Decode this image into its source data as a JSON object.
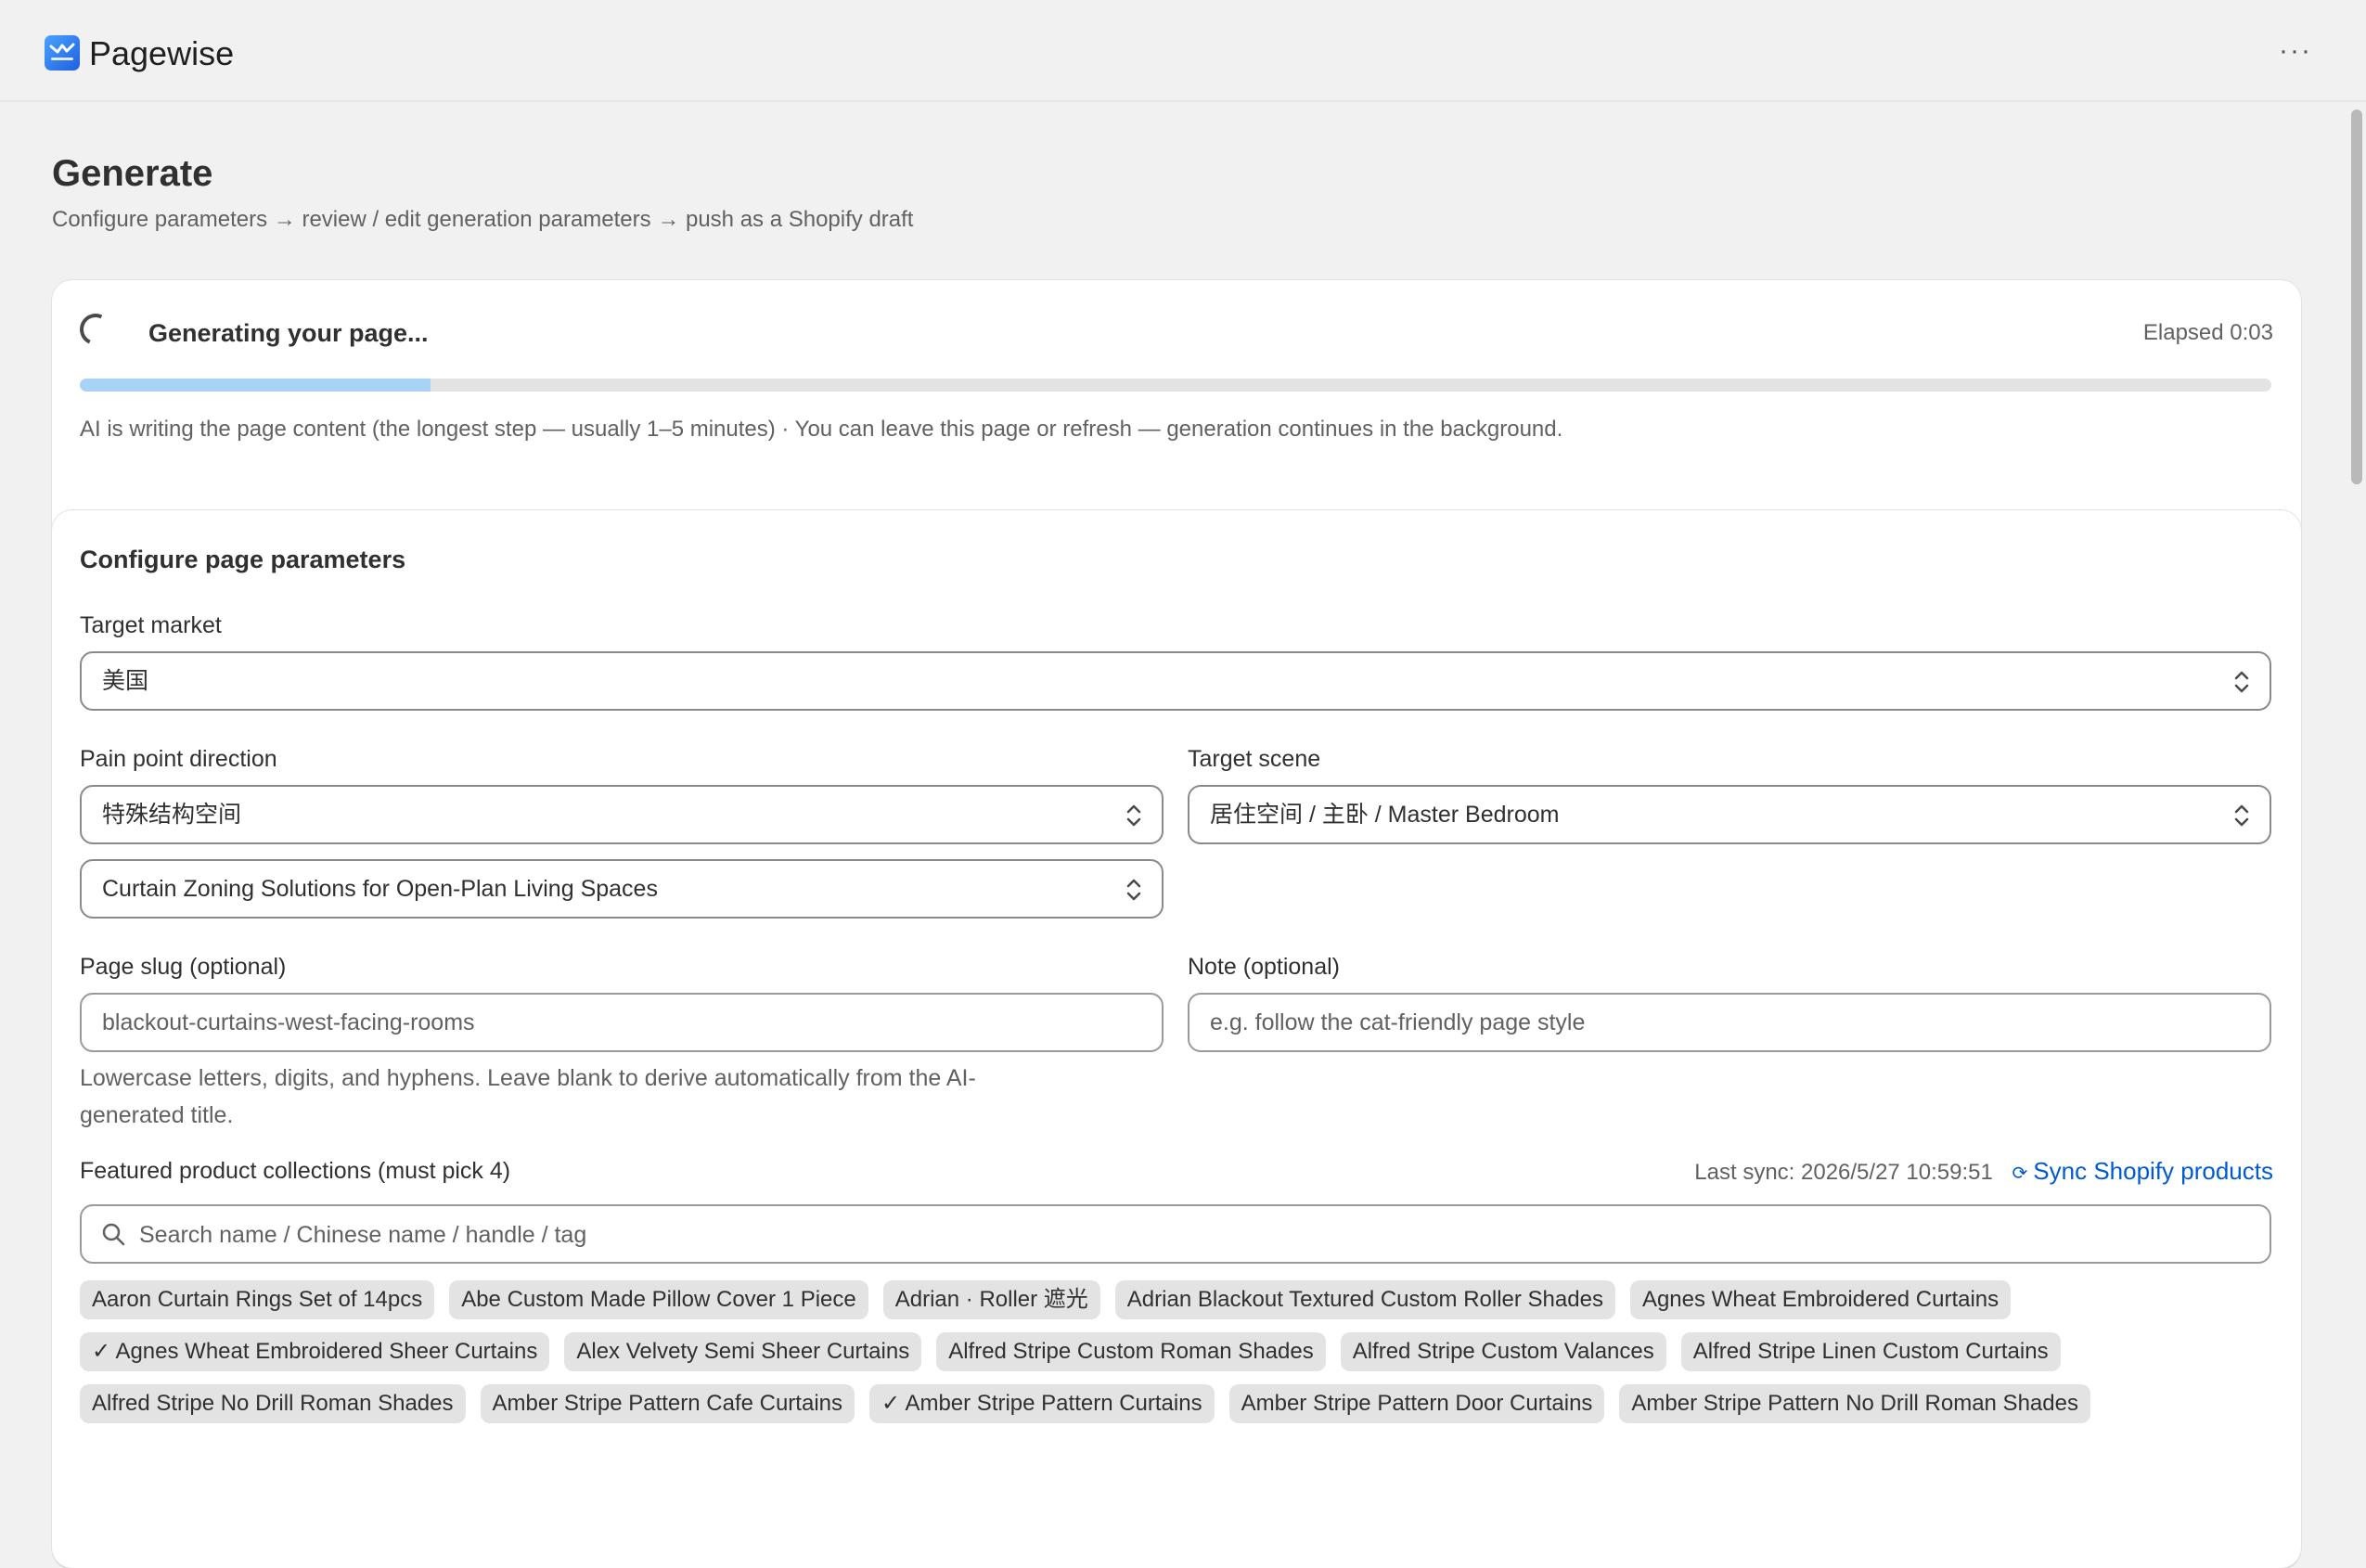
{
  "app": {
    "title": "Pagewise"
  },
  "page": {
    "title": "Generate",
    "subtitle": "Configure parameters → review / edit generation parameters → push as a Shopify draft"
  },
  "progress": {
    "title": "Generating your page...",
    "elapsed": "Elapsed 0:03",
    "fraction": 0.16,
    "note": "AI is writing the page content (the longest step — usually 1–5 minutes) · You can leave this page or refresh — generation continues in the background."
  },
  "config": {
    "title": "Configure page parameters",
    "target_market": {
      "label": "Target market",
      "value": "美国"
    },
    "pain_point": {
      "label": "Pain point direction",
      "value": "特殊结构空间",
      "sub_value": "Curtain Zoning Solutions for Open-Plan Living Spaces"
    },
    "target_scene": {
      "label": "Target scene",
      "value": "居住空间 / 主卧 / Master Bedroom"
    },
    "slug": {
      "label": "Page slug (optional)",
      "value": "blackout-curtains-west-facing-rooms",
      "hint_line1": "Lowercase letters, digits, and hyphens. Leave blank to derive automatically from the AI-",
      "hint_line2": "generated title."
    },
    "note": {
      "label": "Note (optional)",
      "placeholder": "e.g. follow the cat-friendly page style"
    },
    "collections": {
      "label": "Featured product collections (must pick 4)",
      "last_sync": "Last sync: 2026/5/27 10:59:51",
      "sync_label": "Sync Shopify products",
      "search_placeholder": "Search name / Chinese name / handle / tag",
      "rows": [
        [
          "Aaron Curtain Rings Set of 14pcs",
          "Abe Custom Made Pillow Cover 1 Piece",
          "Adrian · Roller 遮光",
          "Adrian Blackout Textured Custom Roller Shades",
          "Agnes Wheat Embroidered Curtains"
        ],
        [
          "✓ Agnes Wheat Embroidered Sheer Curtains",
          "Alex Velvety Semi Sheer Curtains",
          "Alfred Stripe Custom Roman Shades",
          "Alfred Stripe Custom Valances",
          "Alfred Stripe Linen Custom Curtains"
        ],
        [
          "Alfred Stripe No Drill Roman Shades",
          "Amber Stripe Pattern Cafe Curtains",
          "✓ Amber Stripe Pattern Curtains",
          "Amber Stripe Pattern Door Curtains",
          "Amber Stripe Pattern No Drill Roman Shades"
        ]
      ]
    }
  },
  "colors": {
    "accent": "#005bd3",
    "progress_fill": "#a8d3f7",
    "chip_bg": "#e3e3e3"
  }
}
